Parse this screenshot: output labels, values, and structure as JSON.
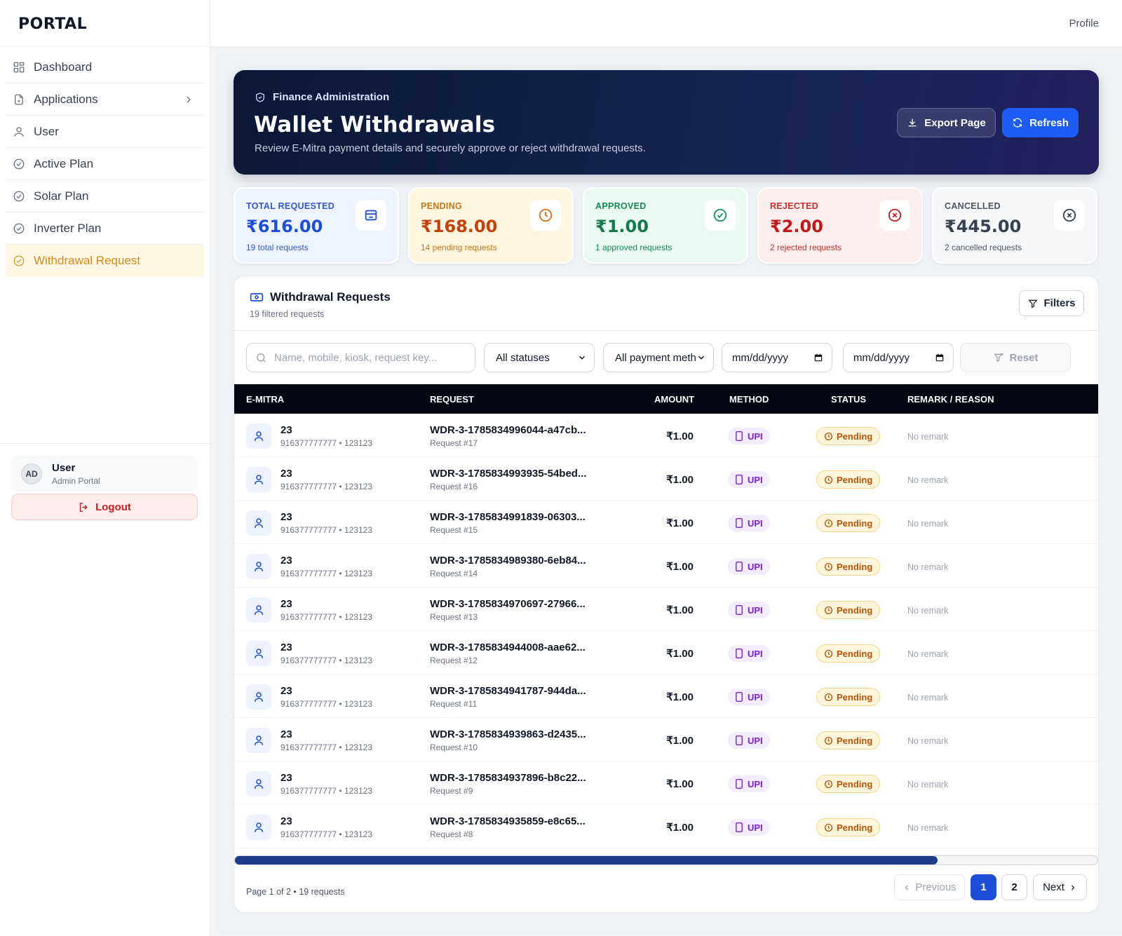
{
  "brand": "PORTAL",
  "topbar": {
    "profile": "Profile"
  },
  "sidebar": {
    "items": [
      {
        "label": "Dashboard",
        "icon": "grid-icon"
      },
      {
        "label": "Applications",
        "icon": "file-icon"
      },
      {
        "label": "User",
        "icon": "user-icon"
      },
      {
        "label": "Active Plan",
        "icon": "check-circle-icon"
      },
      {
        "label": "Solar Plan",
        "icon": "check-circle-icon"
      },
      {
        "label": "Inverter Plan",
        "icon": "check-circle-icon"
      },
      {
        "label": "Withdrawal Request",
        "icon": "check-circle-icon",
        "active": true
      }
    ],
    "user": {
      "initials": "AD",
      "name": "User",
      "role": "Admin Portal"
    },
    "logout": "Logout"
  },
  "hero": {
    "kicker": "Finance Administration",
    "title": "Wallet Withdrawals",
    "subtitle": "Review E-Mitra payment details and securely approve or reject withdrawal requests.",
    "export_label": "Export Page",
    "refresh_label": "Refresh"
  },
  "stats": {
    "total": {
      "label": "TOTAL REQUESTED",
      "value": "₹616.00",
      "sub": "19 total requests"
    },
    "pending": {
      "label": "PENDING",
      "value": "₹168.00",
      "sub": "14 pending requests"
    },
    "approved": {
      "label": "APPROVED",
      "value": "₹1.00",
      "sub": "1 approved requests"
    },
    "rejected": {
      "label": "REJECTED",
      "value": "₹2.00",
      "sub": "2 rejected requests"
    },
    "cancelled": {
      "label": "CANCELLED",
      "value": "₹445.00",
      "sub": "2 cancelled requests"
    }
  },
  "table_card": {
    "title": "Withdrawal Requests",
    "subtitle": "19 filtered requests",
    "filters_label": "Filters",
    "search_placeholder": "Name, mobile, kiosk, request key...",
    "status_select": "All statuses",
    "method_select": "All payment methods",
    "date_from": "mm/dd/yyyy",
    "date_to": "mm/dd/yyyy",
    "reset_label": "Reset",
    "columns": [
      "E-MITRA",
      "REQUEST",
      "AMOUNT",
      "METHOD",
      "STATUS",
      "REMARK / REASON"
    ],
    "rows": [
      {
        "name": "23",
        "contact": "916377777777 • 123123",
        "key": "WDR-3-1785834996044-a47cb...",
        "req": "Request #17",
        "amount": "₹1.00",
        "method": "UPI",
        "status": "Pending",
        "remark": "No remark"
      },
      {
        "name": "23",
        "contact": "916377777777 • 123123",
        "key": "WDR-3-1785834993935-54bed...",
        "req": "Request #16",
        "amount": "₹1.00",
        "method": "UPI",
        "status": "Pending",
        "remark": "No remark"
      },
      {
        "name": "23",
        "contact": "916377777777 • 123123",
        "key": "WDR-3-1785834991839-06303...",
        "req": "Request #15",
        "amount": "₹1.00",
        "method": "UPI",
        "status": "Pending",
        "remark": "No remark"
      },
      {
        "name": "23",
        "contact": "916377777777 • 123123",
        "key": "WDR-3-1785834989380-6eb84...",
        "req": "Request #14",
        "amount": "₹1.00",
        "method": "UPI",
        "status": "Pending",
        "remark": "No remark"
      },
      {
        "name": "23",
        "contact": "916377777777 • 123123",
        "key": "WDR-3-1785834970697-27966...",
        "req": "Request #13",
        "amount": "₹1.00",
        "method": "UPI",
        "status": "Pending",
        "remark": "No remark"
      },
      {
        "name": "23",
        "contact": "916377777777 • 123123",
        "key": "WDR-3-1785834944008-aae62...",
        "req": "Request #12",
        "amount": "₹1.00",
        "method": "UPI",
        "status": "Pending",
        "remark": "No remark"
      },
      {
        "name": "23",
        "contact": "916377777777 • 123123",
        "key": "WDR-3-1785834941787-944da...",
        "req": "Request #11",
        "amount": "₹1.00",
        "method": "UPI",
        "status": "Pending",
        "remark": "No remark"
      },
      {
        "name": "23",
        "contact": "916377777777 • 123123",
        "key": "WDR-3-1785834939863-d2435...",
        "req": "Request #10",
        "amount": "₹1.00",
        "method": "UPI",
        "status": "Pending",
        "remark": "No remark"
      },
      {
        "name": "23",
        "contact": "916377777777 • 123123",
        "key": "WDR-3-1785834937896-b8c22...",
        "req": "Request #9",
        "amount": "₹1.00",
        "method": "UPI",
        "status": "Pending",
        "remark": "No remark"
      },
      {
        "name": "23",
        "contact": "916377777777 • 123123",
        "key": "WDR-3-1785834935859-e8c65...",
        "req": "Request #8",
        "amount": "₹1.00",
        "method": "UPI",
        "status": "Pending",
        "remark": "No remark"
      }
    ],
    "scroll_position": 0.815,
    "pagination": {
      "info": "Page 1 of 2 • 19 requests",
      "previous": "Previous",
      "pages": [
        "1",
        "2"
      ],
      "current": "1",
      "next": "Next"
    }
  }
}
